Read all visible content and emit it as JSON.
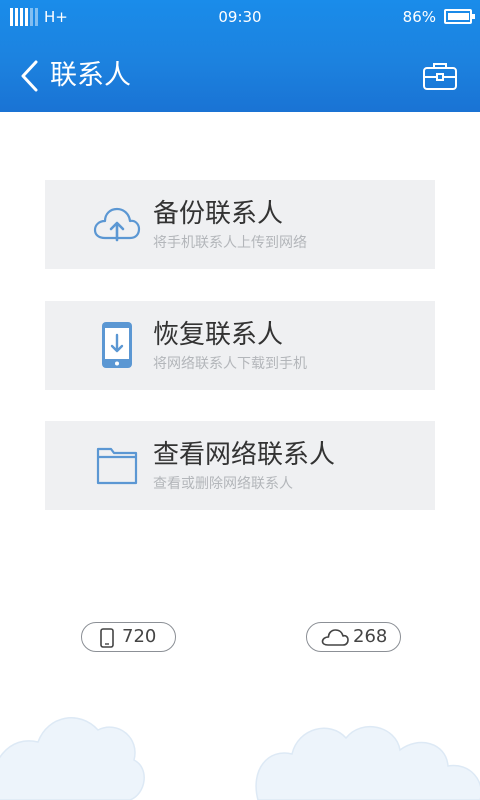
{
  "statusbar": {
    "network": "H+",
    "time": "09:30",
    "battery_percent": "86%",
    "battery_level": 0.86
  },
  "header": {
    "title": "联系人",
    "back_icon": "chevron-left-icon",
    "action_icon": "toolbox-icon"
  },
  "cards": [
    {
      "title": "备份联系人",
      "subtitle": "将手机联系人上传到网络",
      "icon": "cloud-upload-icon"
    },
    {
      "title": "恢复联系人",
      "subtitle": "将网络联系人下载到手机",
      "icon": "phone-download-icon"
    },
    {
      "title": "查看网络联系人",
      "subtitle": "查看或删除网络联系人",
      "icon": "folder-icon"
    }
  ],
  "counts": {
    "phone": "720",
    "cloud": "268"
  },
  "colors": {
    "header_blue": "#1c82df",
    "card_bg": "#eff0f2",
    "icon_blue": "#5b97d3",
    "subtitle_gray": "#b3b6ba"
  }
}
